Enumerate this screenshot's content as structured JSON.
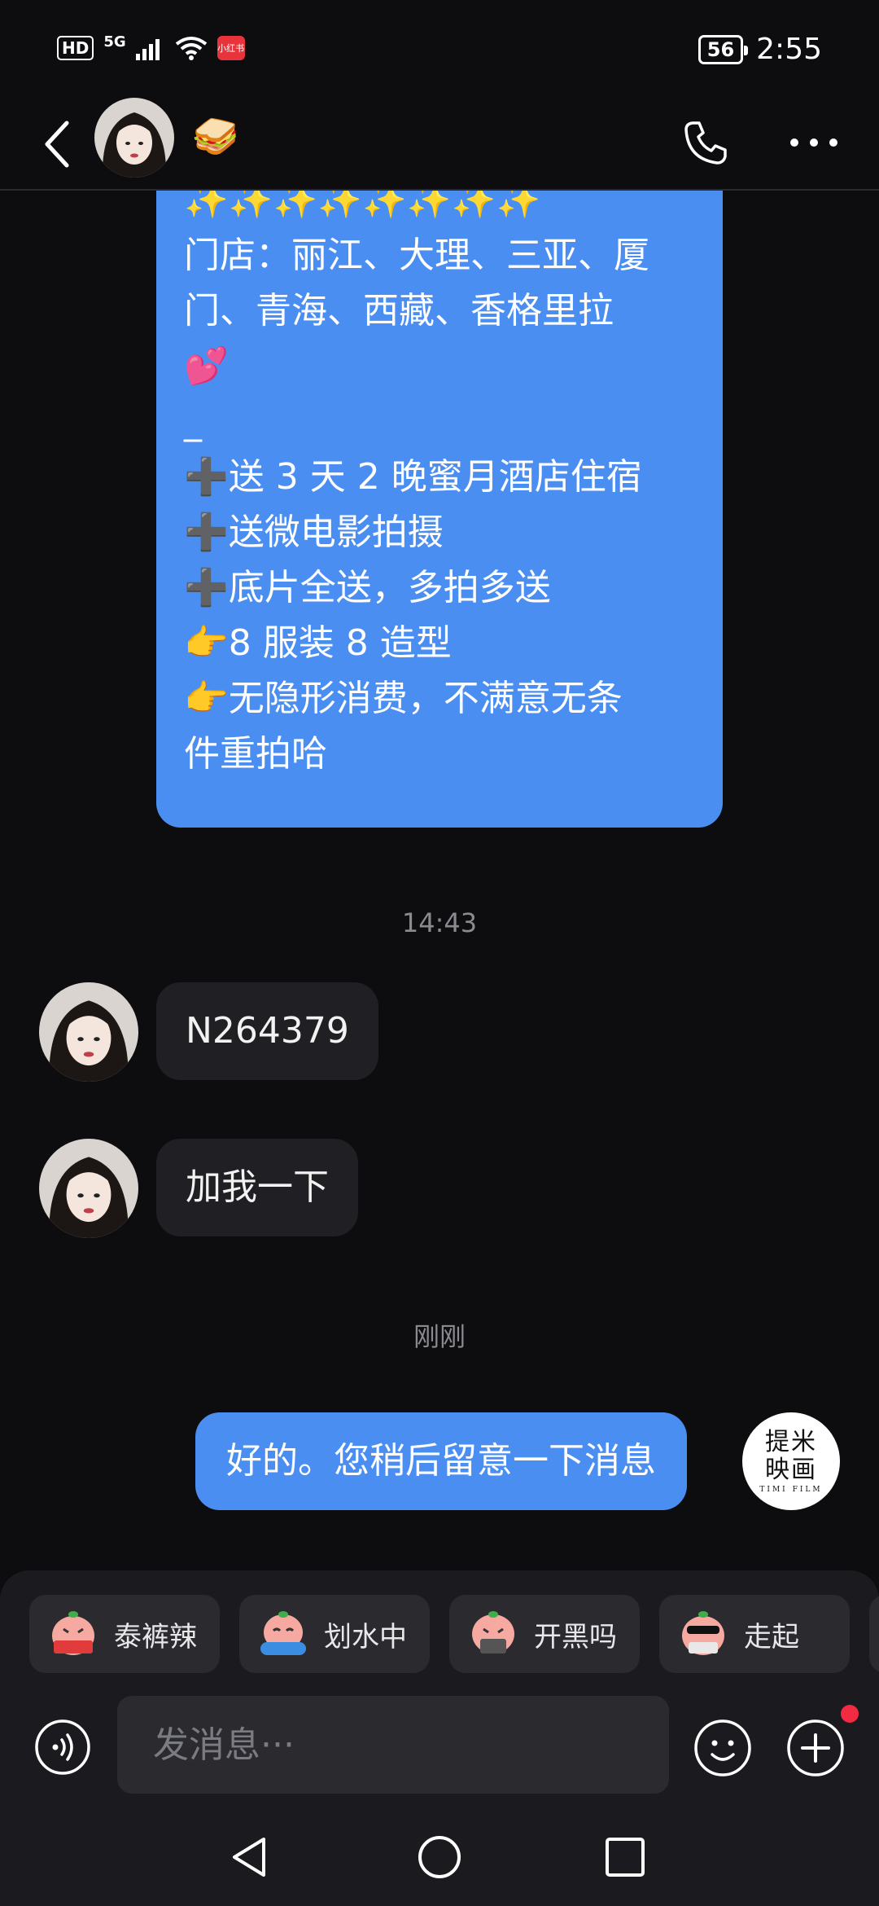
{
  "status_bar": {
    "hd": "HD",
    "network": "5G",
    "app_badge": "小红书",
    "battery": "56",
    "time": "2:55"
  },
  "header": {
    "contact_emoji": "🥪"
  },
  "messages": {
    "promo_lines": [
      "✨✨✨✨✨✨✨✨",
      "门店：丽江、大理、三亚、厦",
      "门、青海、西藏、香格里拉",
      "💕",
      "_",
      "➕送 3 天 2 晚蜜月酒店住宿",
      "➕送微电影拍摄",
      "➕底片全送，多拍多送",
      "👉8 服装 8 造型",
      "👉无隐形消费，不满意无条",
      "件重拍哈"
    ],
    "time_1": "14:43",
    "in_1": "N264379",
    "in_2": "加我一下",
    "time_2": "刚刚",
    "out_1": "好的。您稍后留意一下消息",
    "sender_logo": "提米映画",
    "sender_logo_sub": "TIMI FILM"
  },
  "stickers": [
    {
      "label": "泰裤辣",
      "icon": "sticker-face-icon"
    },
    {
      "label": "划水中",
      "icon": "sticker-face-icon"
    },
    {
      "label": "开黑吗",
      "icon": "sticker-face-icon"
    },
    {
      "label": "走起",
      "icon": "sticker-face-icon"
    }
  ],
  "input": {
    "placeholder": "发消息···"
  },
  "colors": {
    "outgoing_bubble": "#4a8ef2",
    "incoming_bubble": "#202024",
    "background": "#0d0d10",
    "notification_dot": "#f22b42"
  }
}
